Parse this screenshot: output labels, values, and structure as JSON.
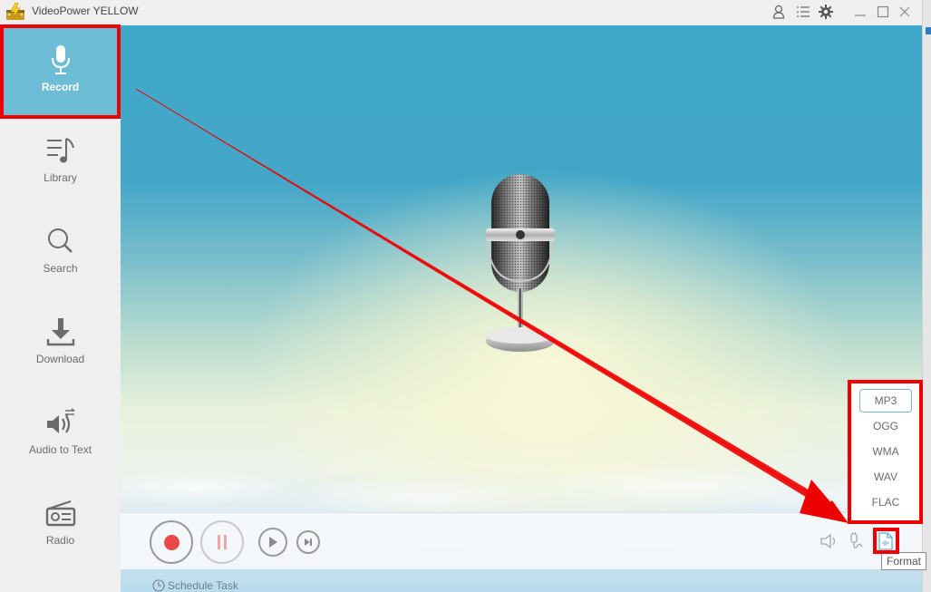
{
  "app": {
    "title": "VideoPower YELLOW",
    "logo_icon": "film-reel-lightning-logo"
  },
  "titlebar_icons": [
    {
      "name": "user-icon",
      "label": "Account"
    },
    {
      "name": "menu-list-icon",
      "label": "Menu"
    },
    {
      "name": "gear-icon",
      "label": "Settings"
    },
    {
      "name": "minimize-icon",
      "label": "Minimize"
    },
    {
      "name": "maximize-icon",
      "label": "Maximize"
    },
    {
      "name": "close-icon",
      "label": "Close"
    }
  ],
  "sidebar": {
    "active": "Record",
    "items": [
      {
        "label": "Record",
        "icon": "microphone-icon"
      },
      {
        "label": "Library",
        "icon": "music-list-icon"
      },
      {
        "label": "Search",
        "icon": "search-icon"
      },
      {
        "label": "Download",
        "icon": "download-icon"
      },
      {
        "label": "Audio to Text",
        "icon": "speaker-convert-icon"
      },
      {
        "label": "Radio",
        "icon": "radio-icon"
      }
    ]
  },
  "main": {
    "illustration": "vintage-microphone",
    "controls": {
      "record": "record-button",
      "pause": "pause-button",
      "play": "play-button",
      "next": "skip-next-button"
    },
    "right_controls": [
      {
        "name": "speaker-volume-icon"
      },
      {
        "name": "microphone-input-icon"
      },
      {
        "name": "format-file-icon",
        "tooltip": "Format"
      }
    ],
    "schedule_label": "Schedule Task"
  },
  "format_menu": {
    "selected": "MP3",
    "options": [
      "MP3",
      "OGG",
      "WMA",
      "WAV",
      "FLAC"
    ]
  },
  "tooltip": "Format",
  "annotation_color": "#ee0000",
  "colors": {
    "sidebar_active": "#6ebdd7",
    "record_dot": "#e84848",
    "pause_bars": "#f0a4a4",
    "format_accent": "#5aaed0"
  }
}
